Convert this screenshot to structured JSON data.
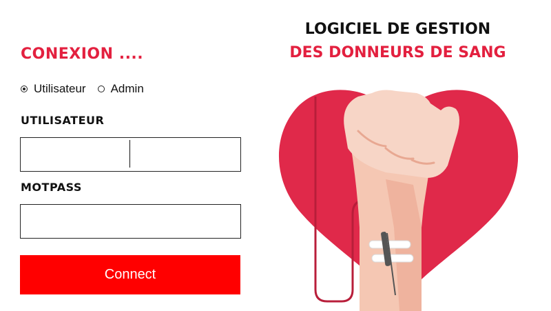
{
  "login": {
    "title": "CONEXION ....",
    "roles": [
      {
        "label": "Utilisateur",
        "checked": true
      },
      {
        "label": "Admin",
        "checked": false
      }
    ],
    "username_label": "UTILISATEUR",
    "username_value": "",
    "password_label": "MOTPASS",
    "password_value": "",
    "connect_label": "Connect"
  },
  "header": {
    "title_line1": "LOGICIEL DE GESTION",
    "title_line2": "DES DONNEURS DE SANG"
  },
  "colors": {
    "accent": "#e3203f",
    "button": "#ff0000",
    "heart": "#e0294a"
  },
  "illustration": {
    "icon": "blood-donation-arm-heart-icon"
  }
}
